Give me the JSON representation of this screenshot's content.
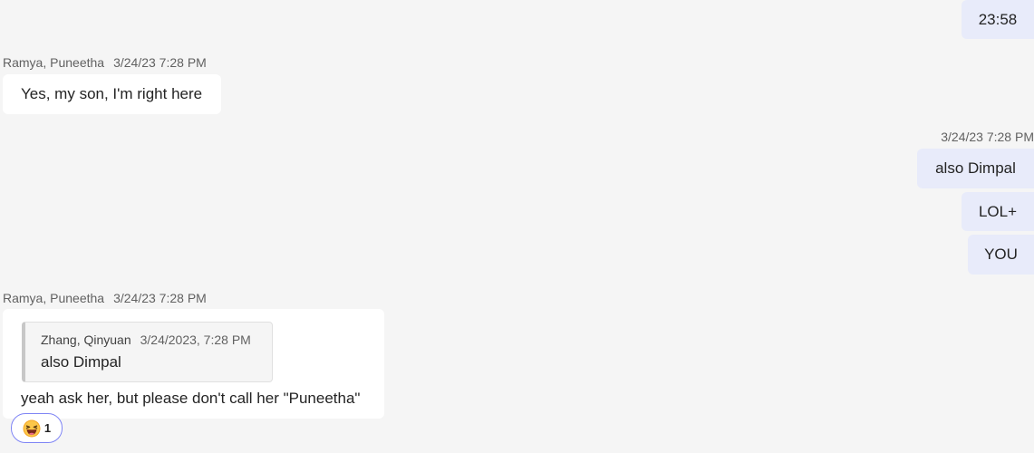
{
  "messages": [
    {
      "type": "sent",
      "text": "23:58"
    },
    {
      "type": "received",
      "sender": "Ramya, Puneetha",
      "time": "3/24/23 7:28 PM",
      "text": "Yes, my son, I'm right here"
    },
    {
      "type": "sent_group",
      "time": "3/24/23 7:28 PM",
      "texts": [
        "also Dimpal",
        "LOL+",
        "YOU"
      ]
    },
    {
      "type": "received",
      "sender": "Ramya, Puneetha",
      "time": "3/24/23 7:28 PM",
      "quote": {
        "author": "Zhang, Qinyuan",
        "time": "3/24/2023, 7:28 PM",
        "text": "also Dimpal"
      },
      "text": "yeah ask her, but please don't call her \"Puneetha\"",
      "reaction": {
        "emoji": "laughing-emoji",
        "count": "1"
      }
    }
  ],
  "colors": {
    "background": "#f5f5f5",
    "incoming_bubble": "#ffffff",
    "outgoing_bubble": "#e8ebfa",
    "reaction_border": "#7f85f5"
  }
}
